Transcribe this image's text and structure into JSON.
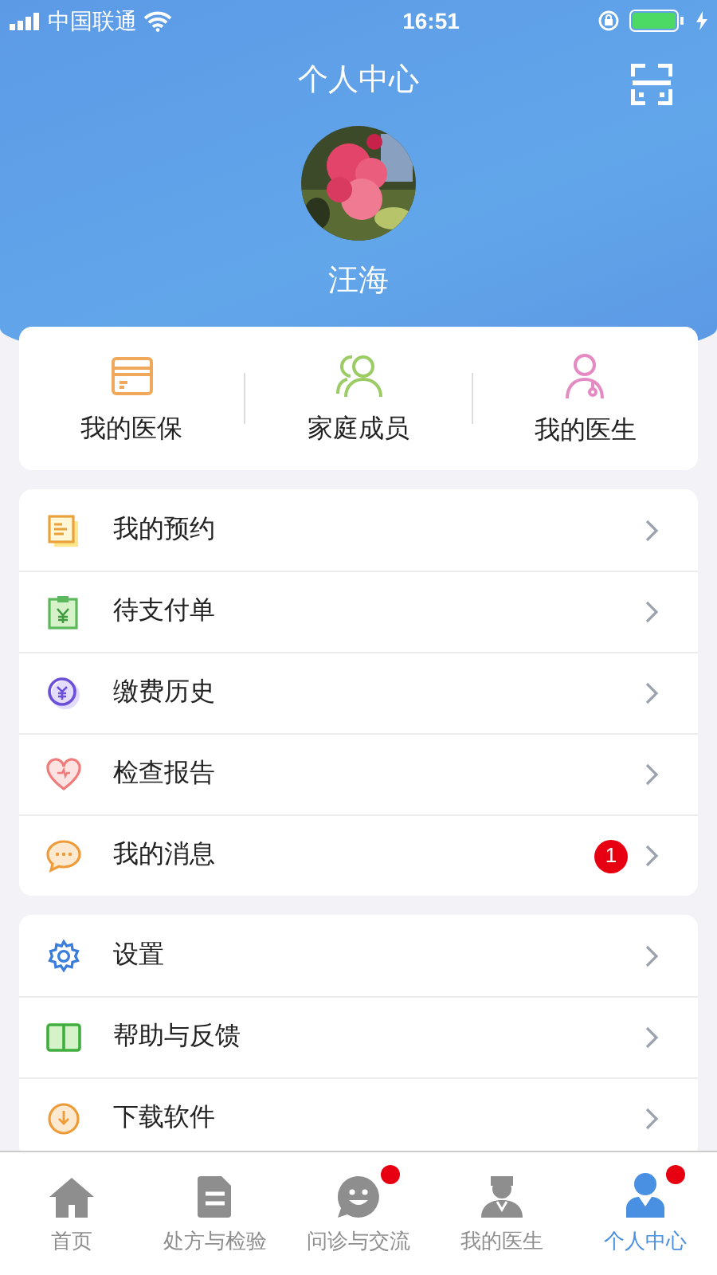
{
  "status_bar": {
    "carrier": "中国联通",
    "time": "16:51"
  },
  "header": {
    "title": "个人中心",
    "user_name": "汪海"
  },
  "shortcuts": [
    {
      "label": "我的医保"
    },
    {
      "label": "家庭成员"
    },
    {
      "label": "我的医生"
    }
  ],
  "menu_groups": [
    {
      "items": [
        {
          "label": "我的预约"
        },
        {
          "label": "待支付单"
        },
        {
          "label": "缴费历史"
        },
        {
          "label": "检查报告"
        },
        {
          "label": "我的消息",
          "badge": "1"
        }
      ]
    },
    {
      "items": [
        {
          "label": "设置"
        },
        {
          "label": "帮助与反馈"
        },
        {
          "label": "下载软件"
        }
      ]
    }
  ],
  "tab_bar": [
    {
      "label": "首页",
      "selected": false,
      "dot": false
    },
    {
      "label": "处方与检验",
      "selected": false,
      "dot": false
    },
    {
      "label": "问诊与交流",
      "selected": false,
      "dot": true
    },
    {
      "label": "我的医生",
      "selected": false,
      "dot": false
    },
    {
      "label": "个人中心",
      "selected": true,
      "dot": true
    }
  ]
}
